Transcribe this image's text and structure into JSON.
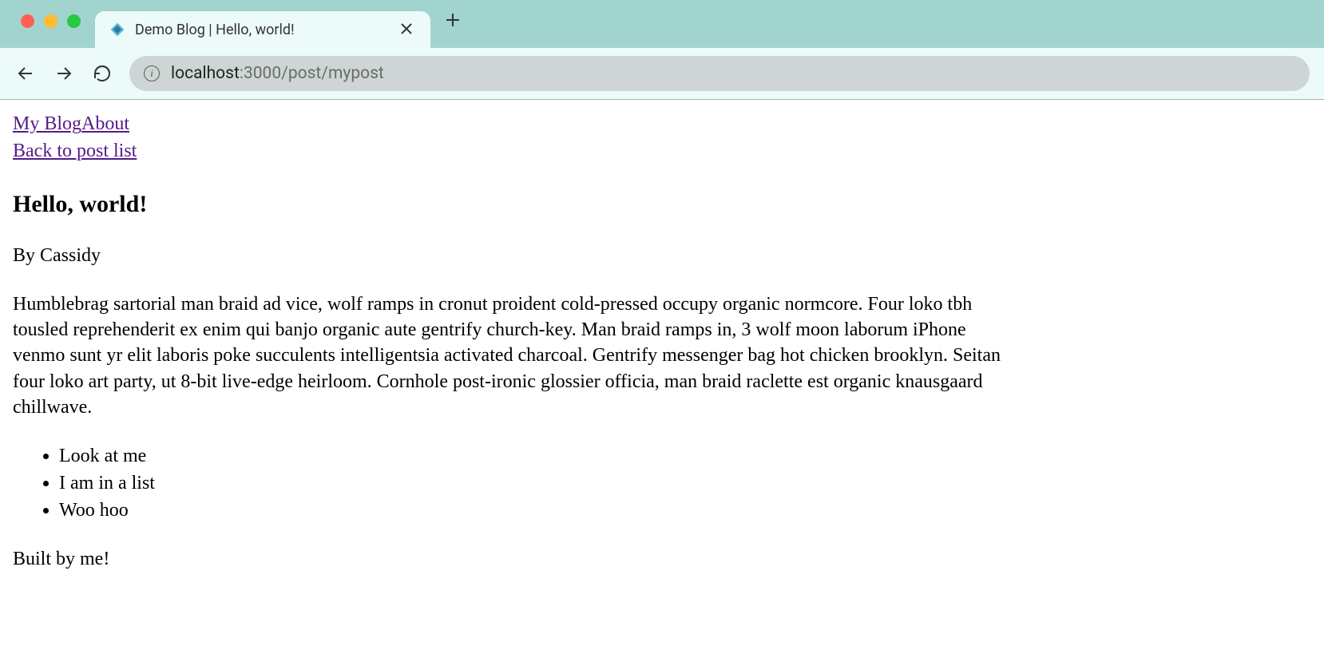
{
  "browser": {
    "tab_title": "Demo Blog | Hello, world!",
    "url_host": "localhost",
    "url_path": ":3000/post/mypost"
  },
  "page": {
    "nav": {
      "home": "My Blog",
      "about": "About",
      "back": "Back to post list"
    },
    "title": "Hello, world!",
    "byline": "By Cassidy",
    "body": "Humblebrag sartorial man braid ad vice, wolf ramps in cronut proident cold-pressed occupy organic normcore. Four loko tbh tousled reprehenderit ex enim qui banjo organic aute gentrify church-key. Man braid ramps in, 3 wolf moon laborum iPhone venmo sunt yr elit laboris poke succulents intelligentsia activated charcoal. Gentrify messenger bag hot chicken brooklyn. Seitan four loko art party, ut 8-bit live-edge heirloom. Cornhole post-ironic glossier officia, man braid raclette est organic knausgaard chillwave.",
    "list": [
      "Look at me",
      "I am in a list",
      "Woo hoo"
    ],
    "footer": "Built by me!"
  }
}
